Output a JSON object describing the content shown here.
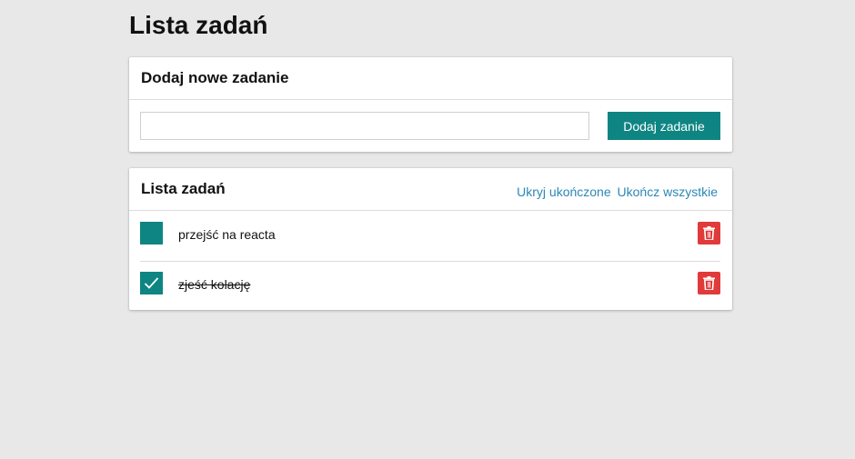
{
  "page": {
    "title": "Lista zadań"
  },
  "add_card": {
    "title": "Dodaj nowe zadanie",
    "input_value": "",
    "input_placeholder": "",
    "button_label": "Dodaj zadanie"
  },
  "list_card": {
    "title": "Lista zadań",
    "hide_completed_label": "Ukryj ukończone",
    "complete_all_label": "Ukończ wszystkie",
    "tasks": [
      {
        "text": "przejść na reacta",
        "completed": false
      },
      {
        "text": "zjeść kolację",
        "completed": true
      }
    ]
  },
  "icons": {
    "checkbox_checked": "check-icon",
    "delete": "trash-icon"
  },
  "colors": {
    "background": "#e8e8e9",
    "accent_teal": "#0e8582",
    "link_blue": "#2a87b5",
    "delete_red": "#e03a3a"
  }
}
